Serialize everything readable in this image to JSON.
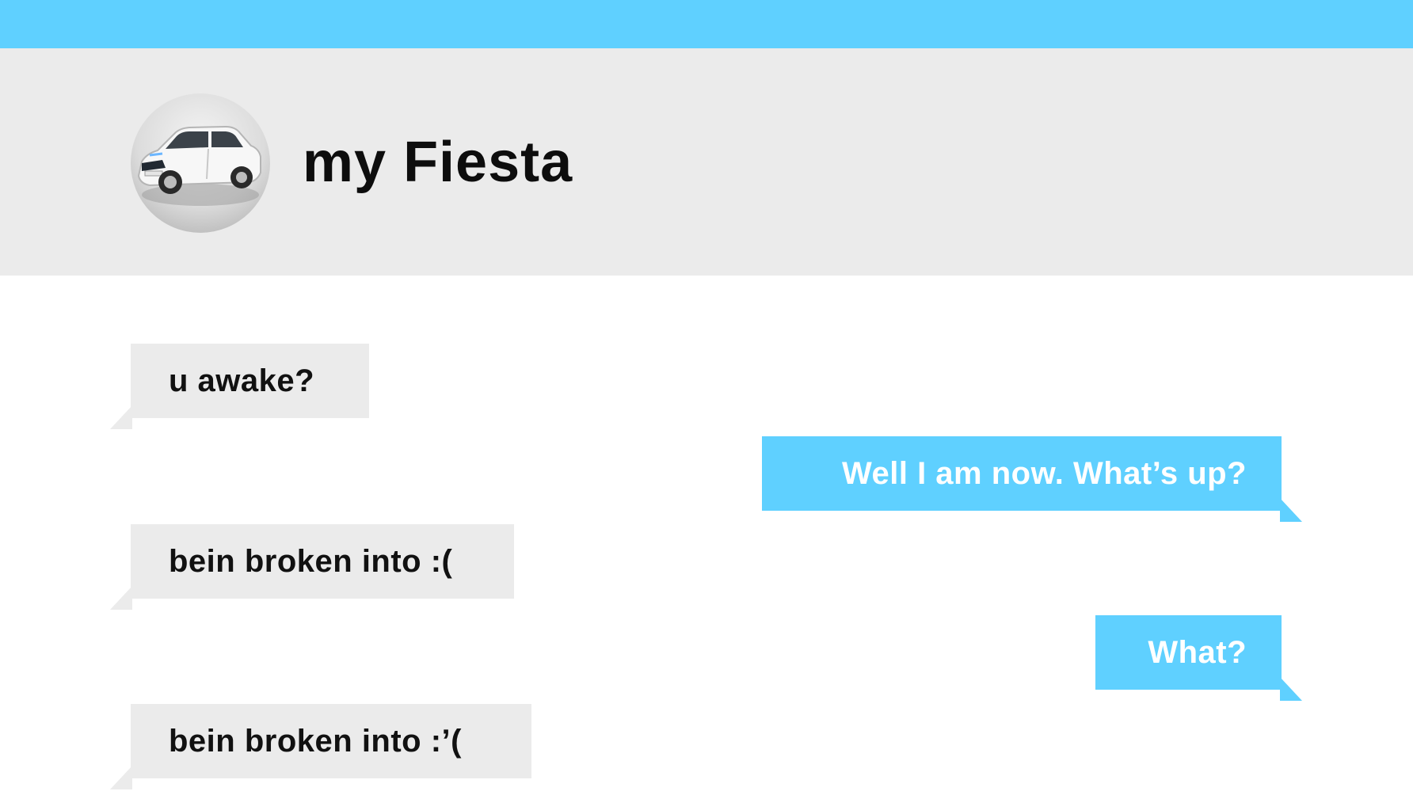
{
  "header": {
    "contact_name": "my Fiesta",
    "avatar_icon": "car-avatar"
  },
  "colors": {
    "accent": "#5fd0ff",
    "incoming_bubble": "#ebebeb",
    "header_background": "#ebebeb",
    "incoming_text": "#111111",
    "outgoing_text": "#ffffff"
  },
  "messages": [
    {
      "direction": "incoming",
      "text": "u awake?"
    },
    {
      "direction": "outgoing",
      "text": "Well I am now. What’s up?"
    },
    {
      "direction": "incoming",
      "text": "bein broken into :("
    },
    {
      "direction": "outgoing",
      "text": "What?"
    },
    {
      "direction": "incoming",
      "text": "bein broken into :’("
    }
  ]
}
